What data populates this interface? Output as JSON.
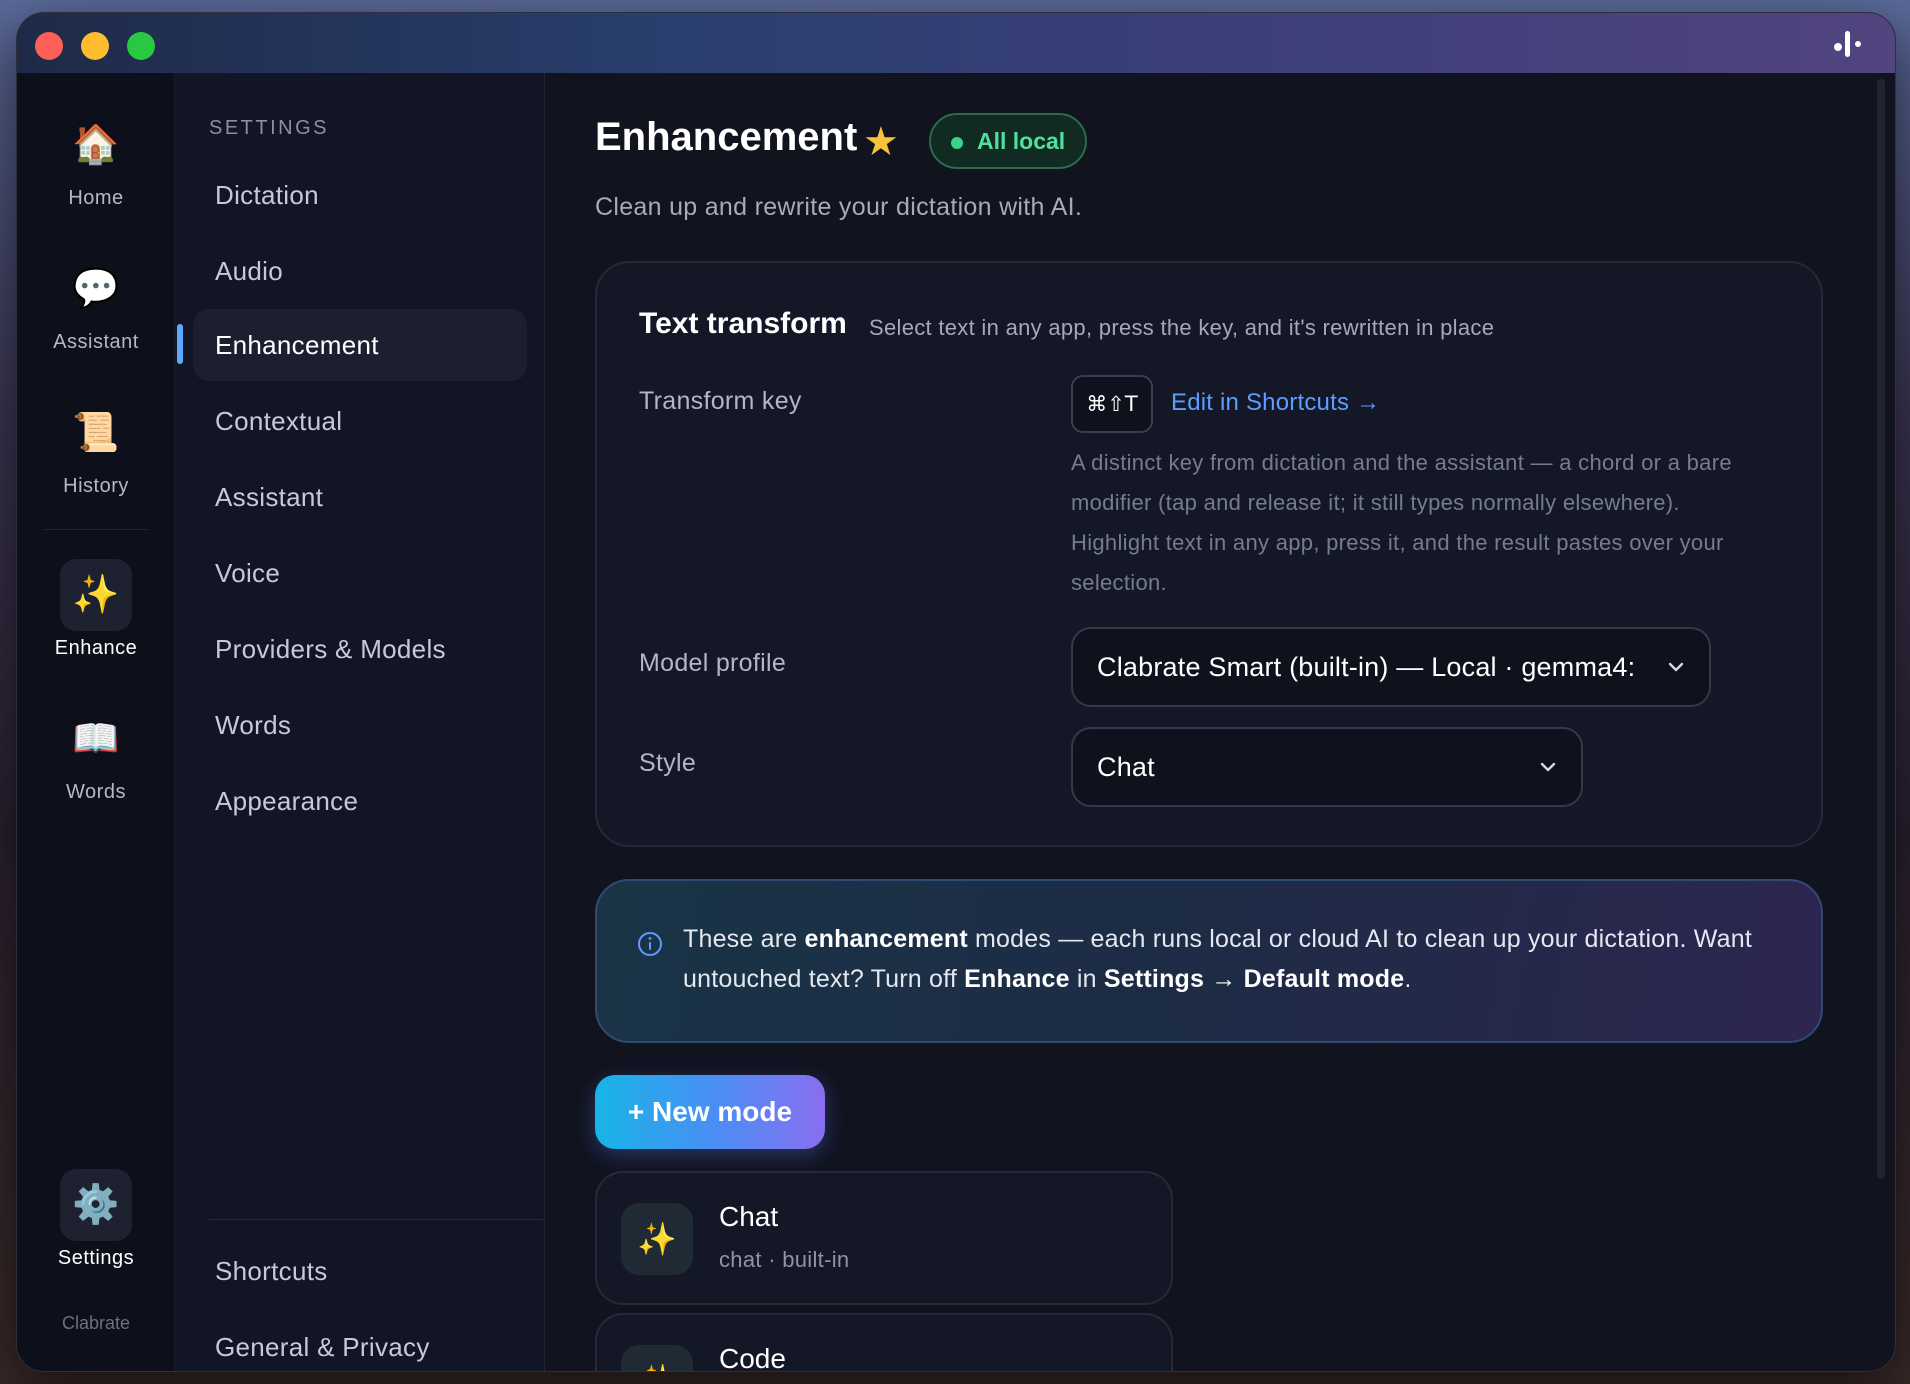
{
  "window": {
    "title": ""
  },
  "rail": {
    "items": [
      {
        "label": "Home",
        "icon": "house-icon"
      },
      {
        "label": "Assistant",
        "icon": "speech-bubble-icon"
      },
      {
        "label": "History",
        "icon": "scroll-icon"
      },
      {
        "label": "Enhance",
        "icon": "sparkles-icon",
        "active": true
      },
      {
        "label": "Words",
        "icon": "book-icon"
      },
      {
        "label": "Settings",
        "icon": "gear-icon"
      }
    ],
    "brand": "Clabrate"
  },
  "settings_nav": {
    "heading": "SETTINGS",
    "items": [
      "Dictation",
      "Audio",
      "Enhancement",
      "Contextual",
      "Assistant",
      "Voice",
      "Providers & Models",
      "Words",
      "Appearance"
    ],
    "active": "Enhancement",
    "footer_items": [
      "Shortcuts",
      "General & Privacy"
    ]
  },
  "page": {
    "title": "Enhancement",
    "star": "★",
    "badge": "All local",
    "subtitle": "Clean up and rewrite your dictation with AI."
  },
  "text_transform": {
    "title": "Text transform",
    "description": "Select text in any app, press the key, and it's rewritten in place",
    "transform_key_label": "Transform key",
    "transform_key_value": "⌘⇧T",
    "edit_link": "Edit in Shortcuts →",
    "help": "A distinct key from dictation and the assistant — a chord or a bare modifier (tap and release it; it still types normally elsewhere). Highlight text in any app, press it, and the result pastes over your selection.",
    "model_profile_label": "Model profile",
    "model_profile_value": "Clabrate Smart (built-in) — Local · gemma4:",
    "style_label": "Style",
    "style_value": "Chat"
  },
  "info": {
    "p1": "These are ",
    "b1": "enhancement",
    "p2": " modes — each runs local or cloud AI to clean up your dictation. Want untouched text? Turn off ",
    "b2": "Enhance",
    "p3": " in ",
    "b3": "Settings → Default mode",
    "p4": "."
  },
  "new_mode_button": "+ New mode",
  "modes": [
    {
      "name": "Chat",
      "meta": "chat · built-in",
      "icon": "sparkles-icon"
    },
    {
      "name": "Code",
      "meta": "",
      "icon": "sparkles-icon"
    }
  ],
  "colors": {
    "accent": "#5e9cff",
    "badge_green": "#4fe0a0",
    "star": "#f7c33b"
  }
}
